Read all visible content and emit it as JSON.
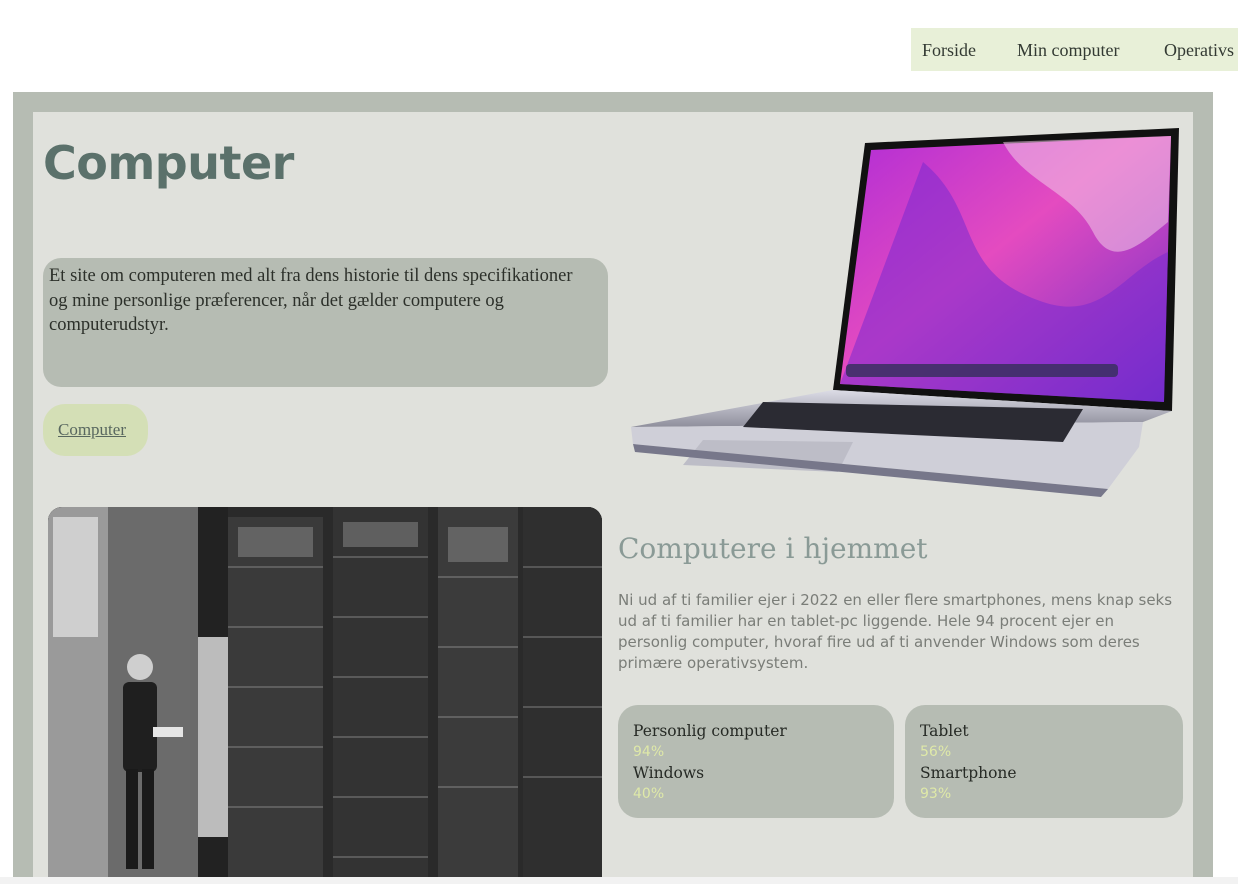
{
  "nav": {
    "items": [
      {
        "label": "Forside"
      },
      {
        "label": "Min computer"
      },
      {
        "label": "Operativs"
      }
    ]
  },
  "hero": {
    "title": "Computer",
    "intro": "Et site om computeren med alt fra dens historie til dens specifikationer og mine personlige præferencer, når det gælder computere og computerudstyr.",
    "link_label": "Computer"
  },
  "home_section": {
    "title": "Computere i hjemmet",
    "text": "Ni ud af ti familier ejer i 2022 en eller flere smartphones, mens knap seks ud af ti familier har en tablet-pc liggende. Hele 94 procent ejer en personlig computer, hvoraf fire ud af ti anvender Windows som deres primære operativsystem.",
    "stats_left": [
      {
        "label": "Personlig computer",
        "value": "94%"
      },
      {
        "label": "Windows",
        "value": "40%"
      }
    ],
    "stats_right": [
      {
        "label": "Tablet",
        "value": "56%"
      },
      {
        "label": "Smartphone",
        "value": "93%"
      }
    ]
  },
  "colors": {
    "nav_bg": "#e8f0d8",
    "frame": "#b6bcb3",
    "panel": "#e0e1dc",
    "title": "#5b716b",
    "pill": "#d4dfb6",
    "stat_value": "#dfe9a8"
  }
}
